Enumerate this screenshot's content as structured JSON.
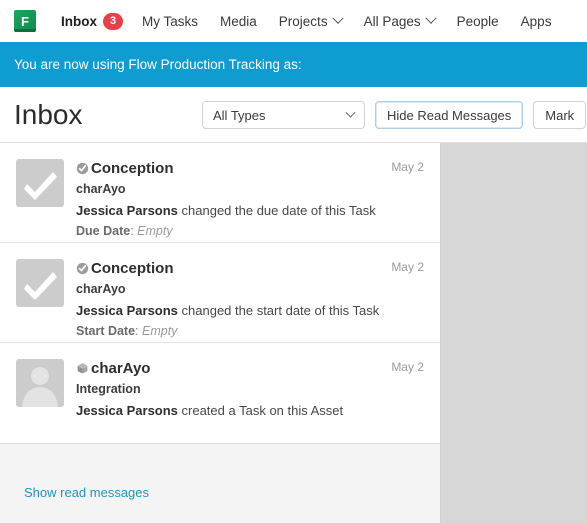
{
  "nav": {
    "logo_letter": "F",
    "items": [
      {
        "label": "Inbox",
        "badge": "3",
        "strong": true,
        "caret": false
      },
      {
        "label": "My Tasks",
        "badge": null,
        "strong": false,
        "caret": false
      },
      {
        "label": "Media",
        "badge": null,
        "strong": false,
        "caret": false
      },
      {
        "label": "Projects",
        "badge": null,
        "strong": false,
        "caret": true
      },
      {
        "label": "All Pages",
        "badge": null,
        "strong": false,
        "caret": true
      },
      {
        "label": "People",
        "badge": null,
        "strong": false,
        "caret": false
      },
      {
        "label": "Apps",
        "badge": null,
        "strong": false,
        "caret": false
      }
    ]
  },
  "banner": {
    "text": "You are now using Flow Production Tracking as:",
    "color": "#0e9cd1"
  },
  "header": {
    "title": "Inbox",
    "type_filter_value": "All Types",
    "hide_read_label": "Hide Read Messages",
    "mark_label": "Mark"
  },
  "items": [
    {
      "thumb": "task-check-thumbnail",
      "type_icon": "task-icon",
      "title": "Conception",
      "subtitle": "charAyo",
      "actor": "Jessica Parsons",
      "action": " changed the due date of this Task",
      "field_label": "Due Date",
      "field_value": "Empty",
      "date": "May 2"
    },
    {
      "thumb": "task-check-thumbnail",
      "type_icon": "task-icon",
      "title": "Conception",
      "subtitle": "charAyo",
      "actor": "Jessica Parsons",
      "action": " changed the start date of this Task",
      "field_label": "Start Date",
      "field_value": "Empty",
      "date": "May 2"
    },
    {
      "thumb": "person-avatar-thumbnail",
      "type_icon": "asset-cube-icon",
      "title": "charAyo",
      "subtitle": "Integration",
      "actor": "Jessica Parsons",
      "action": " created a Task on this Asset",
      "field_label": null,
      "field_value": null,
      "date": "May 2"
    }
  ],
  "footer": {
    "show_read_label": "Show read messages",
    "link_color": "#1b97c7"
  }
}
